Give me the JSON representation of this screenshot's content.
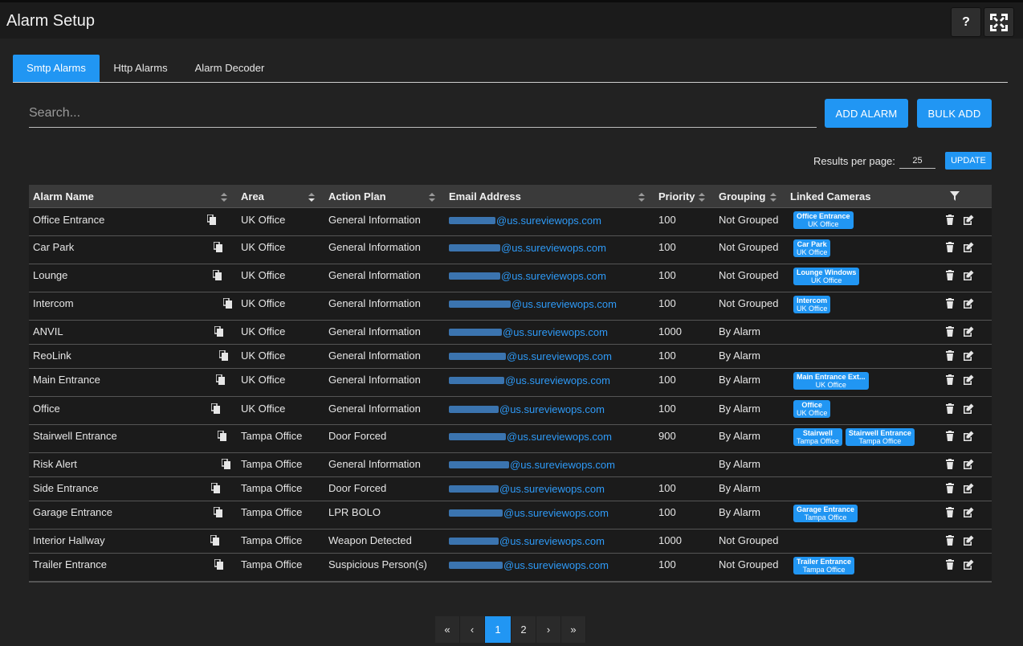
{
  "header": {
    "title": "Alarm Setup",
    "help_label": "?"
  },
  "tabs": [
    {
      "label": "Smtp Alarms",
      "active": true
    },
    {
      "label": "Http Alarms",
      "active": false
    },
    {
      "label": "Alarm Decoder",
      "active": false
    }
  ],
  "search": {
    "placeholder": "Search...",
    "value": ""
  },
  "buttons": {
    "add_alarm": "ADD ALARM",
    "bulk_add": "BULK ADD",
    "update": "UPDATE"
  },
  "pagination_controls": {
    "results_label": "Results per page:",
    "results_value": "25"
  },
  "table": {
    "columns": [
      "Alarm Name",
      "Area",
      "Action Plan",
      "Email Address",
      "Priority",
      "Grouping",
      "Linked Cameras"
    ],
    "email_domain": "@us.sureviewops.com",
    "rows": [
      {
        "name": "Office Entrance",
        "area": "UK Office",
        "plan": "General Information",
        "priority": "100",
        "grouping": "Not Grouped",
        "cameras": [
          {
            "name": "Office Entrance",
            "area": "UK Office"
          }
        ]
      },
      {
        "name": "Car Park",
        "area": "UK Office",
        "plan": "General Information",
        "priority": "100",
        "grouping": "Not Grouped",
        "cameras": [
          {
            "name": "Car Park",
            "area": "UK Office"
          }
        ]
      },
      {
        "name": "Lounge",
        "area": "UK Office",
        "plan": "General Information",
        "priority": "100",
        "grouping": "Not Grouped",
        "cameras": [
          {
            "name": "Lounge Windows",
            "area": "UK Office"
          }
        ]
      },
      {
        "name": "Intercom",
        "area": "UK Office",
        "plan": "General Information",
        "priority": "100",
        "grouping": "Not Grouped",
        "cameras": [
          {
            "name": "Intercom",
            "area": "UK Office"
          }
        ]
      },
      {
        "name": "ANVIL",
        "area": "UK Office",
        "plan": "General Information",
        "priority": "1000",
        "grouping": "By Alarm",
        "cameras": []
      },
      {
        "name": "ReoLink",
        "area": "UK Office",
        "plan": "General Information",
        "priority": "100",
        "grouping": "By Alarm",
        "cameras": []
      },
      {
        "name": "Main Entrance",
        "area": "UK Office",
        "plan": "General Information",
        "priority": "100",
        "grouping": "By Alarm",
        "cameras": [
          {
            "name": "Main Entrance Ext...",
            "area": "UK Office"
          }
        ]
      },
      {
        "name": "Office",
        "area": "UK Office",
        "plan": "General Information",
        "priority": "100",
        "grouping": "By Alarm",
        "cameras": [
          {
            "name": "Office",
            "area": "UK Office"
          }
        ]
      },
      {
        "name": "Stairwell Entrance",
        "area": "Tampa Office",
        "plan": "Door Forced",
        "priority": "900",
        "grouping": "By Alarm",
        "cameras": [
          {
            "name": "Stairwell",
            "area": "Tampa Office"
          },
          {
            "name": "Stairwell Entrance",
            "area": "Tampa Office"
          }
        ]
      },
      {
        "name": "Risk Alert",
        "area": "Tampa Office",
        "plan": "General Information",
        "priority": "",
        "grouping": "By Alarm",
        "cameras": []
      },
      {
        "name": "Side Entrance",
        "area": "Tampa Office",
        "plan": "Door Forced",
        "priority": "100",
        "grouping": "By Alarm",
        "cameras": []
      },
      {
        "name": "Garage Entrance",
        "area": "Tampa Office",
        "plan": "LPR BOLO",
        "priority": "100",
        "grouping": "By Alarm",
        "cameras": [
          {
            "name": "Garage Entrance",
            "area": "Tampa Office"
          }
        ]
      },
      {
        "name": "Interior Hallway",
        "area": "Tampa Office",
        "plan": "Weapon Detected",
        "priority": "1000",
        "grouping": "Not Grouped",
        "cameras": []
      },
      {
        "name": "Trailer Entrance",
        "area": "Tampa Office",
        "plan": "Suspicious Person(s)",
        "priority": "100",
        "grouping": "Not Grouped",
        "cameras": [
          {
            "name": "Trailer Entrance",
            "area": "Tampa Office"
          }
        ]
      }
    ]
  },
  "pager": {
    "first": "«",
    "prev": "‹",
    "pages": [
      "1",
      "2"
    ],
    "current": "1",
    "next": "›",
    "last": "»"
  },
  "colors": {
    "accent": "#2196f3",
    "background": "#222222",
    "row": "#1b1b1b",
    "header_row": "#3a3a3a",
    "link": "#2e9af7"
  },
  "icons": [
    "help-icon",
    "fullscreen-icon",
    "sort-icon",
    "filter-icon",
    "copy-icon",
    "delete-icon",
    "edit-icon"
  ]
}
